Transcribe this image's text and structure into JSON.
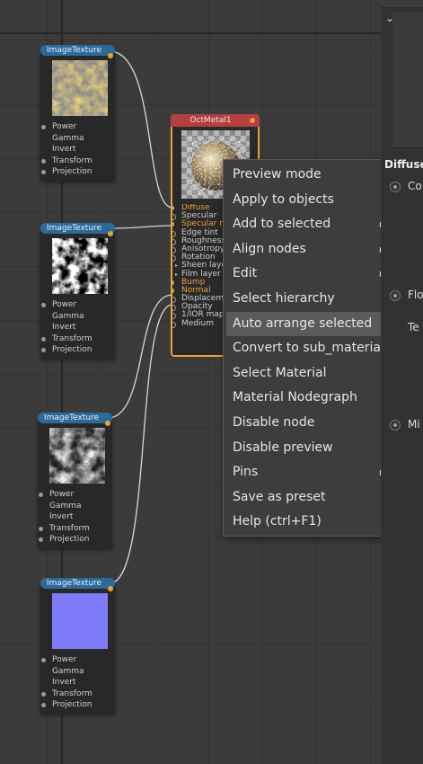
{
  "texture_nodes": [
    {
      "title": "ImageTexture",
      "inputs": [
        "Power",
        "Gamma",
        "Invert",
        "Transform",
        "Projection"
      ]
    },
    {
      "title": "ImageTexture",
      "inputs": [
        "Power",
        "Gamma",
        "Invert",
        "Transform",
        "Projection"
      ]
    },
    {
      "title": "ImageTexture",
      "inputs": [
        "Power",
        "Gamma",
        "Invert",
        "Transform",
        "Projection"
      ]
    },
    {
      "title": "ImageTexture",
      "inputs": [
        "Power",
        "Gamma",
        "Invert",
        "Transform",
        "Projection"
      ]
    }
  ],
  "material_node": {
    "title": "OctMetal1",
    "inputs": [
      "Diffuse",
      "Specular",
      "Specular m",
      "Edge tint",
      "Roughness",
      "Anisotropy",
      "Rotation",
      "Sheen laye",
      "Film layer",
      "Bump",
      "Normal",
      "Displaceme",
      "Opacity",
      "1/IOR map",
      "Medium"
    ]
  },
  "context_menu": {
    "items": [
      {
        "label": "Preview mode",
        "submenu": false
      },
      {
        "label": "Apply to objects",
        "submenu": false
      },
      {
        "label": "Add to selected",
        "submenu": true
      },
      {
        "label": "Align nodes",
        "submenu": true
      },
      {
        "label": "Edit",
        "submenu": true
      },
      {
        "label": "Select hierarchy",
        "submenu": false
      },
      {
        "label": "Auto arrange selected",
        "submenu": false,
        "highlighted": true
      },
      {
        "label": "Convert to sub_material",
        "submenu": false
      },
      {
        "label": "Select Material",
        "submenu": false
      },
      {
        "label": "Material Nodegraph",
        "submenu": false
      },
      {
        "label": "Disable node",
        "submenu": false
      },
      {
        "label": "Disable preview",
        "submenu": false
      },
      {
        "label": "Pins",
        "submenu": true
      },
      {
        "label": "Save as preset",
        "submenu": false
      },
      {
        "label": "Help (ctrl+F1)",
        "submenu": false
      }
    ]
  },
  "right_panel": {
    "section_title": "Diffuse",
    "rows": [
      "Co",
      "Flo",
      "Te",
      "Mi"
    ]
  },
  "colors": {
    "texture_header": "#2c6b99",
    "material_header": "#b43f3f",
    "selection_accent": "#e8a23a",
    "menu_highlight": "#5a5a5a"
  }
}
